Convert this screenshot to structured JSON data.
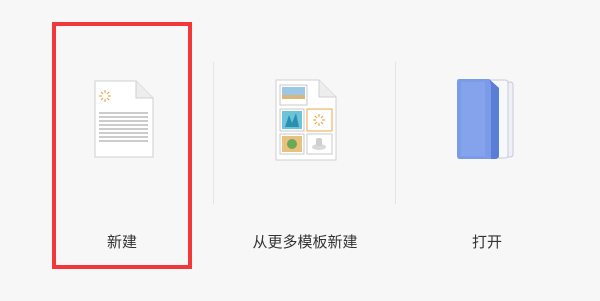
{
  "options": [
    {
      "id": "new",
      "label": "新建",
      "icon": "blank-document-icon",
      "selected": true
    },
    {
      "id": "new-from-template",
      "label": "从更多模板新建",
      "icon": "template-document-icon",
      "selected": false
    },
    {
      "id": "open",
      "label": "打开",
      "icon": "folder-icon",
      "selected": false
    }
  ],
  "colors": {
    "selection_border": "#f2383b",
    "folder_blue": "#6b8fe6",
    "background": "#f7f7f7"
  }
}
